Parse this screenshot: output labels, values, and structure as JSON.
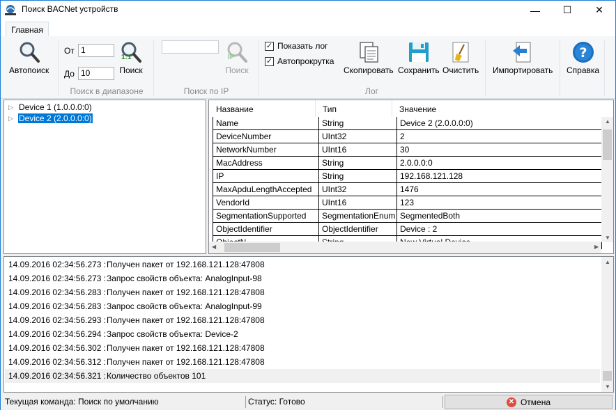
{
  "window": {
    "title": "Поиск BACNet устройств",
    "minimize": "—",
    "maximize": "☐",
    "close": "✕"
  },
  "ribbon": {
    "tab": "Главная",
    "autosearch_label": "Автопоиск",
    "from_label": "От",
    "from_value": "1",
    "to_label": "До",
    "to_value": "10",
    "range_search_badge": "1:1",
    "range_search_label": "Поиск",
    "range_group": "Поиск в диапазоне",
    "ip_badge": "IP",
    "ip_search_label": "Поиск",
    "ip_group": "Поиск по IP",
    "show_log_label": "Показать лог",
    "show_log_checked": true,
    "autoscroll_label": "Автопрокрутка",
    "autoscroll_checked": true,
    "copy_label": "Скопировать",
    "save_label": "Сохранить",
    "clear_label": "Очистить",
    "log_group": "Лог",
    "import_label": "Импортировать",
    "help_label": "Справка"
  },
  "tree": {
    "items": [
      {
        "label": "Device 1 (1.0.0.0:0)",
        "selected": false
      },
      {
        "label": "Device 2 (2.0.0.0:0)",
        "selected": true
      }
    ]
  },
  "grid": {
    "headers": [
      "Название",
      "Тип",
      "Значение"
    ],
    "rows": [
      [
        "Name",
        "String",
        "Device 2 (2.0.0.0:0)"
      ],
      [
        "DeviceNumber",
        "UInt32",
        "2"
      ],
      [
        "NetworkNumber",
        "UInt16",
        "30"
      ],
      [
        "MacAddress",
        "String",
        "2.0.0.0:0"
      ],
      [
        "IP",
        "String",
        "192.168.121.128"
      ],
      [
        "MaxApduLengthAccepted",
        "UInt32",
        "1476"
      ],
      [
        "VendorId",
        "UInt16",
        "123"
      ],
      [
        "SegmentationSupported",
        "SegmentationEnum",
        "SegmentedBoth"
      ],
      [
        "ObjectIdentifier",
        "ObjectIdentifier",
        "Device : 2"
      ],
      [
        "ObjectN",
        "String",
        "New Virtual Device"
      ]
    ]
  },
  "log": {
    "lines": [
      {
        "ts": "14.09.2016 02:34:56.273 :",
        "msg": "Получен пакет от 192.168.121.128:47808"
      },
      {
        "ts": "14.09.2016 02:34:56.273 :",
        "msg": "Запрос свойств объекта: AnalogInput-98"
      },
      {
        "ts": "14.09.2016 02:34:56.283 :",
        "msg": "Получен пакет от 192.168.121.128:47808"
      },
      {
        "ts": "14.09.2016 02:34:56.283 :",
        "msg": "Запрос свойств объекта: AnalogInput-99"
      },
      {
        "ts": "14.09.2016 02:34:56.293 :",
        "msg": "Получен пакет от 192.168.121.128:47808"
      },
      {
        "ts": "14.09.2016 02:34:56.294 :",
        "msg": "Запрос свойств объекта: Device-2"
      },
      {
        "ts": "14.09.2016 02:34:56.302 :",
        "msg": "Получен пакет от 192.168.121.128:47808"
      },
      {
        "ts": "14.09.2016 02:34:56.312 :",
        "msg": "Получен пакет от 192.168.121.128:47808"
      },
      {
        "ts": "14.09.2016 02:34:56.321 :",
        "msg": "Количество объектов 101"
      }
    ]
  },
  "status": {
    "command": "Текущая команда: Поиск по умолчанию",
    "state": "Статус: Готово",
    "cancel_label": "Отмена"
  },
  "colors": {
    "accent": "#0078d7",
    "window_border": "#1c7ed6"
  }
}
